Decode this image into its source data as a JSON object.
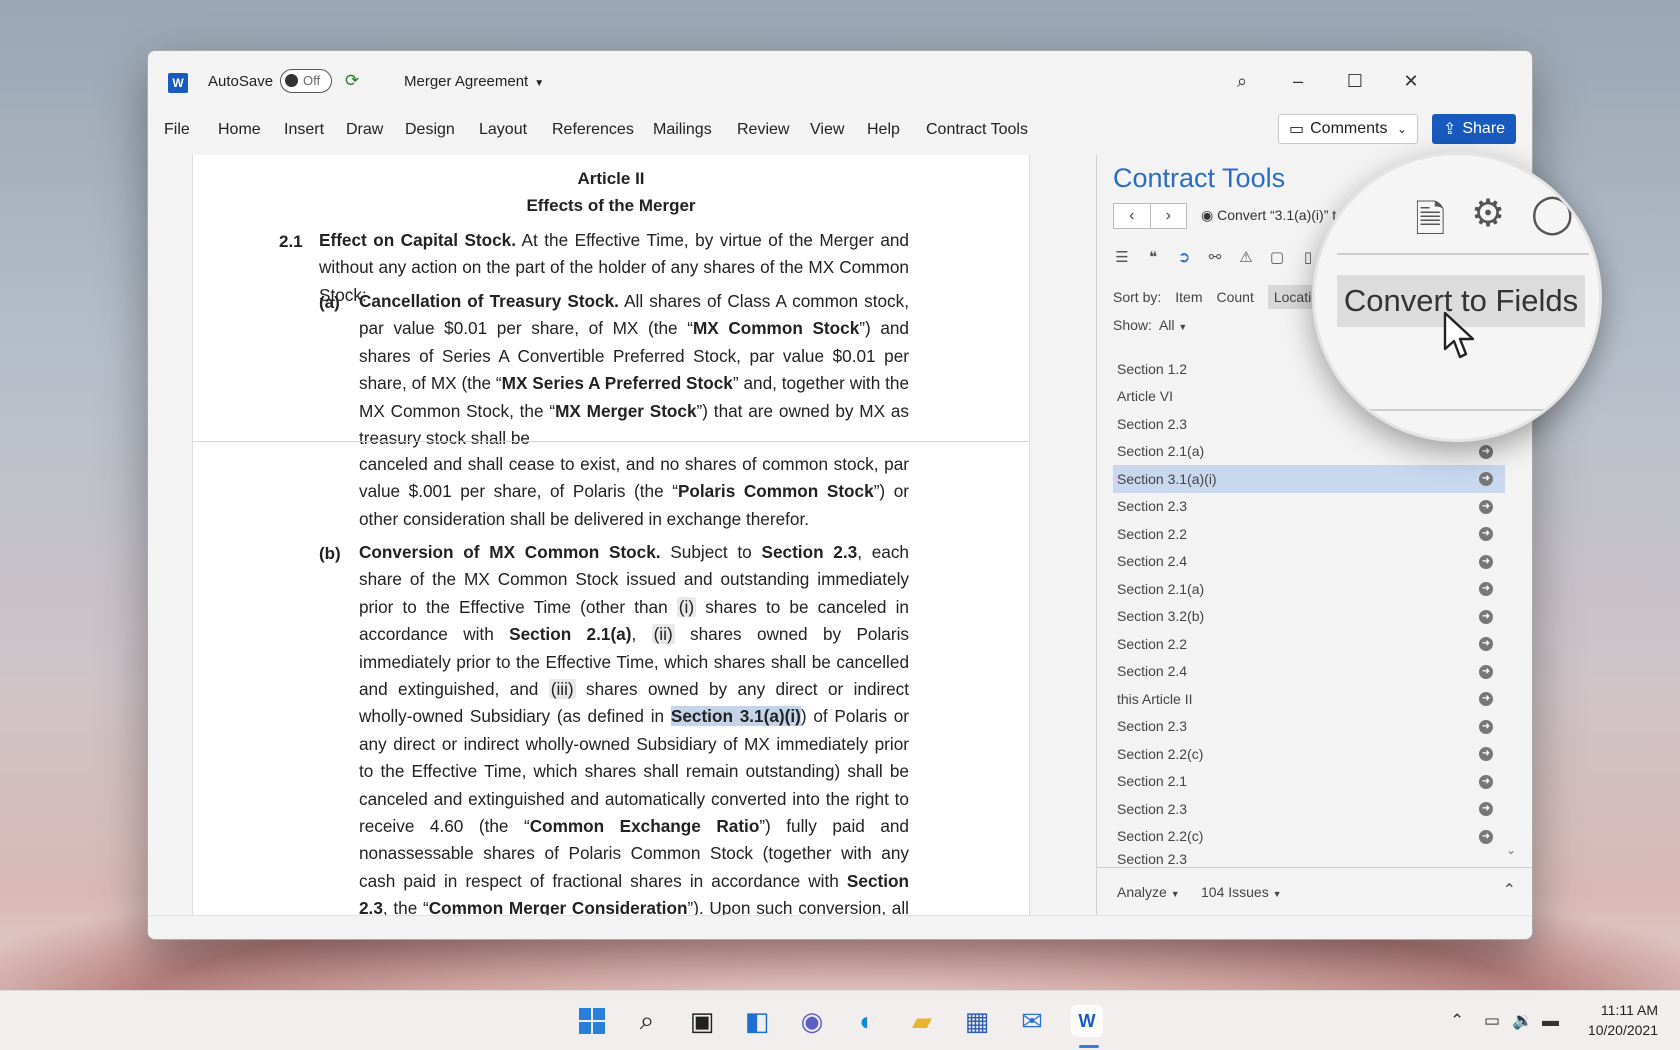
{
  "app": {
    "logo_letter": "W",
    "autosave_label": "AutoSave",
    "autosave_state": "Off",
    "document_title": "Merger Agreement"
  },
  "menu": [
    "File",
    "Home",
    "Insert",
    "Draw",
    "Design",
    "Layout",
    "References",
    "Mailings",
    "Review",
    "View",
    "Help",
    "Contract Tools"
  ],
  "buttons": {
    "comments": "Comments",
    "share": "Share"
  },
  "document": {
    "article": "Article II",
    "article_title": "Effects of the Merger",
    "sec_num": "2.1",
    "sec_heading": "Effect on Capital Stock.",
    "sec_text": "At the Effective Time, by virtue of the Merger and without any action on the part of the holder of any shares of the MX Common Stock:",
    "a_label": "(a)",
    "a_heading": "Cancellation of Treasury Stock.",
    "a_text_1": "All shares of Class A common stock, par value $0.01 per share, of MX (the “",
    "a_def_1": "MX Common Stock",
    "a_text_2": "”) and shares of Series A Convertible Preferred Stock, par value $0.01 per share, of MX (the “",
    "a_def_2": "MX Series A Preferred Stock",
    "a_text_3": "” and, together with the MX Common Stock, the “",
    "a_def_3": "MX Merger Stock",
    "a_text_4": "”) that are owned by MX as treasury stock shall be",
    "a_cont_1": "canceled and shall cease to exist, and no shares of common stock, par value $.001 per share, of Polaris (the “",
    "a_def_4": "Polaris Common Stock",
    "a_cont_2": "”) or other consideration shall be delivered in exchange therefor.",
    "b_label": "(b)",
    "b_heading": "Conversion of MX Common Stock.",
    "b_t1": "Subject to ",
    "b_ref1": "Section 2.3",
    "b_t2": ", each share of the MX Common Stock issued and outstanding immediately prior to the Effective Time (other than ",
    "b_i": "(i)",
    "b_t3": " shares to be canceled in accordance with ",
    "b_ref2": "Section 2.1(a)",
    "b_t4": ", ",
    "b_ii": "(ii)",
    "b_t5": " shares owned by Polaris immediately prior to the Effective Time, which shares shall be cancelled and extinguished, and ",
    "b_iii": "(iii)",
    "b_t6": " shares owned by any direct or indirect wholly-owned Subsidiary (as defined in ",
    "b_ref3": "Section 3.1(a)(i)",
    "b_t7": ") of Polaris or any direct or indirect wholly-owned Subsidiary of MX immediately prior to the Effective Time, which shares shall remain outstanding) shall be canceled and extinguished and automatically converted into the right to receive 4.60 (the “",
    "b_def1": "Common Exchange Ratio",
    "b_t8": "”) fully paid and nonassessable shares of Polaris Common Stock (together with any cash paid in respect of fractional shares in accordance with ",
    "b_ref4": "Section 2.3",
    "b_t9": ", the “",
    "b_def2": "Common Merger Consideration",
    "b_t10": "”). Upon such conversion, all such shares of the MX Common Stock shall no longer be outstand-"
  },
  "pane": {
    "title": "Contract Tools",
    "convert_label": "Convert “3.1(a)(i)” t",
    "sort_label": "Sort by:",
    "sort_options": [
      "Item",
      "Count",
      "Locatio"
    ],
    "show_label": "Show:",
    "show_value": "All",
    "items": [
      "Section 1.2",
      "Article VI",
      "Section 2.3",
      "Section 2.1(a)",
      "Section 3.1(a)(i)",
      "Section 2.3",
      "Section 2.2",
      "Section 2.4",
      "Section 2.1(a)",
      "Section 3.2(b)",
      "Section 2.2",
      "Section 2.4",
      "this Article II",
      "Section 2.3",
      "Section 2.2(c)",
      "Section 2.1",
      "Section 2.3",
      "Section 2.2(c)",
      "Section 2.3"
    ],
    "selected_index": 4,
    "analyze_label": "Analyze",
    "issues_label": "104 Issues"
  },
  "magnifier": {
    "button_label": "Convert to Fields"
  },
  "taskbar": {
    "time": "11:11 AM",
    "date": "10/20/2021",
    "icons": [
      "start-icon",
      "search-icon",
      "task-view-icon",
      "widgets-icon",
      "teams-chat-icon",
      "edge-icon",
      "file-explorer-icon",
      "store-icon",
      "mail-icon",
      "word-icon"
    ]
  },
  "colors": {
    "accent": "#185abd",
    "pane_title": "#2b6cc4",
    "selection": "#c9d8ef"
  }
}
